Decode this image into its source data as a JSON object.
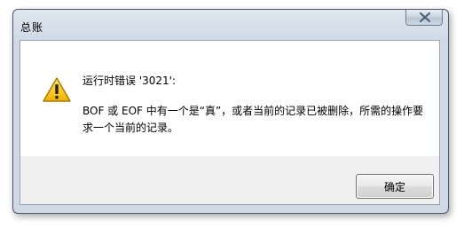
{
  "window": {
    "title": "总账"
  },
  "titlebar": {
    "close_icon": "close-icon"
  },
  "message": {
    "icon": "warning-icon",
    "heading": "运行时错误 '3021':",
    "body": "BOF 或 EOF 中有一个是“真”，或者当前的记录已被删除，所需的操作要求一个当前的记录。"
  },
  "buttons": {
    "ok_label": "确定"
  }
}
